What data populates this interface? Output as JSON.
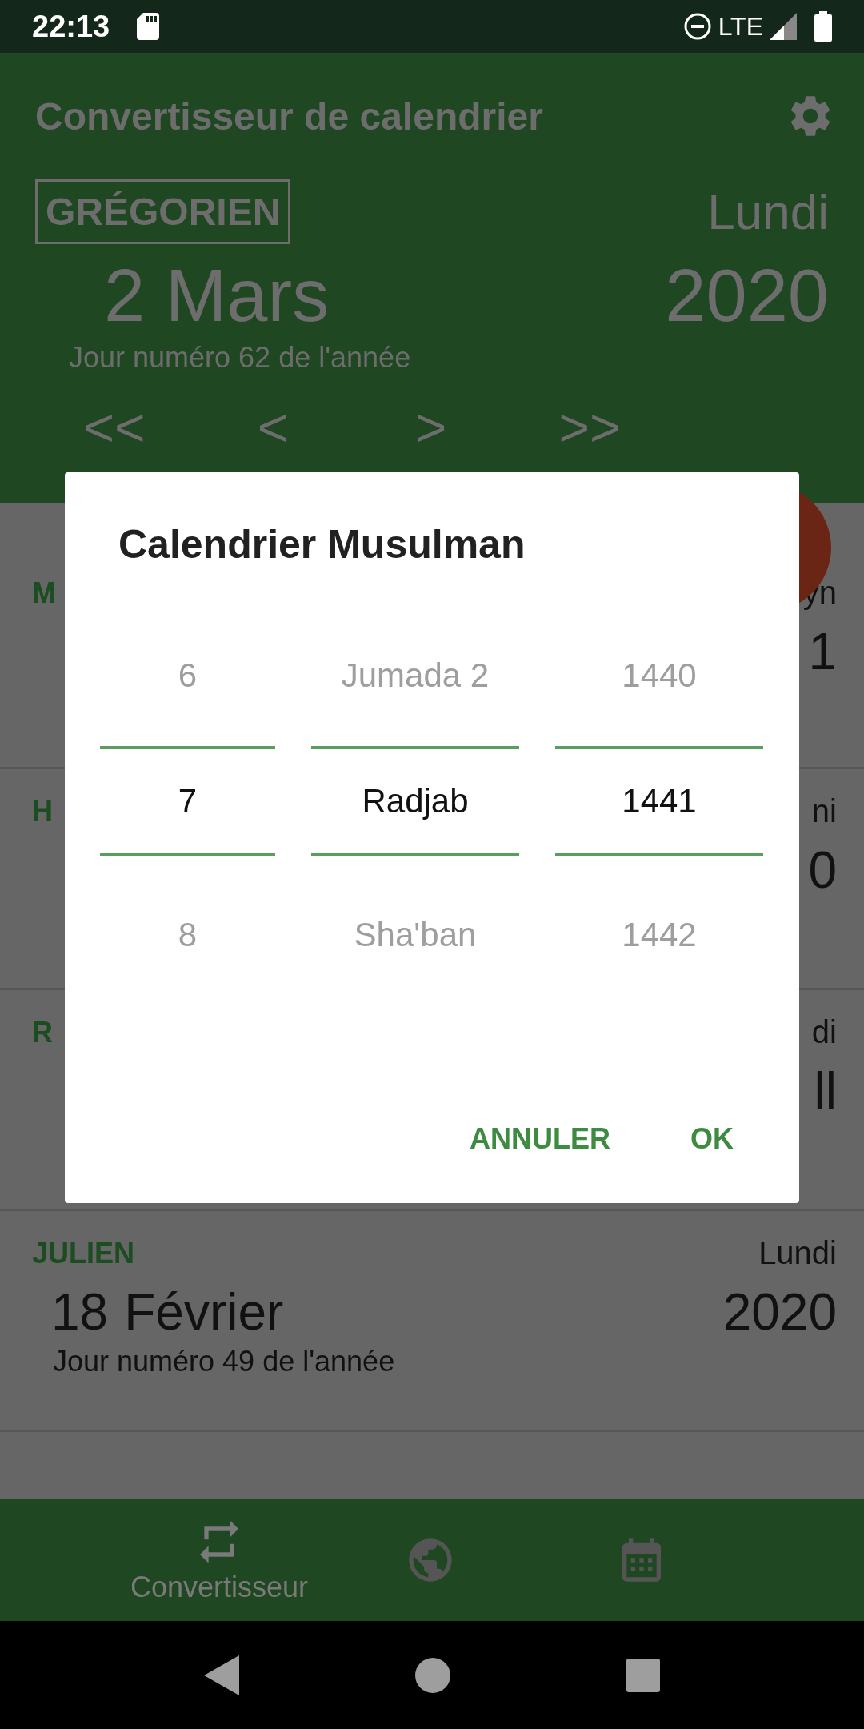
{
  "status_bar": {
    "time": "22:13",
    "network": "LTE"
  },
  "app_bar": {
    "title": "Convertisseur de calendrier"
  },
  "header": {
    "calendar_label": "GRÉGORIEN",
    "weekday": "Lundi",
    "day_month": "2 Mars",
    "year": "2020",
    "day_of_year": "Jour numéro 62 de l'année",
    "nav_buttons": [
      "<<",
      "<",
      ">",
      ">>"
    ]
  },
  "cards": [
    {
      "label": "M",
      "weekday": "yn",
      "year": "1"
    },
    {
      "label": "H",
      "weekday": "ni",
      "year": "0"
    },
    {
      "label": "R",
      "weekday": "di",
      "year": "ll"
    },
    {
      "label": "JULIEN",
      "weekday": "Lundi",
      "day": "18",
      "month": "Février",
      "year": "2020",
      "day_of_year": "Jour numéro 49 de l'année"
    }
  ],
  "dialog": {
    "title": "Calendrier Musulman",
    "pickers": [
      {
        "items": [
          {
            "text": "6",
            "selected": false
          },
          {
            "text": "7",
            "selected": true
          },
          {
            "text": "8",
            "selected": false
          }
        ]
      },
      {
        "items": [
          {
            "text": "Jumada 2",
            "selected": false
          },
          {
            "text": "Radjab",
            "selected": true
          },
          {
            "text": "Sha'ban",
            "selected": false
          }
        ]
      },
      {
        "items": [
          {
            "text": "1440",
            "selected": false
          },
          {
            "text": "1441",
            "selected": true
          },
          {
            "text": "1442",
            "selected": false
          }
        ]
      }
    ],
    "buttons": [
      "ANNULER",
      "OK"
    ]
  },
  "bottom_nav": [
    {
      "kind": "convert",
      "label": "Convertisseur",
      "selected": true
    },
    {
      "kind": "globe",
      "selected": false
    },
    {
      "kind": "calendar",
      "selected": false
    }
  ]
}
